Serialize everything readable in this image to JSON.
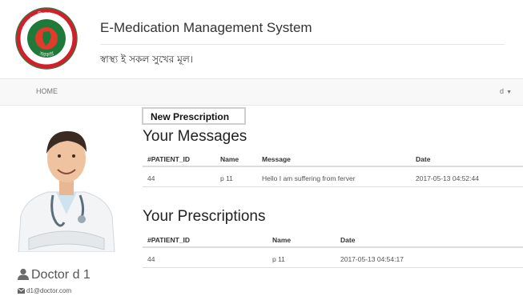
{
  "header": {
    "app_title": "E-Medication Management System",
    "tagline": "স্বাস্থ্য ই সকল সুখের মূল।"
  },
  "logo": {
    "top_text": "গণপ্রজাতন্ত্রী বাংলাদেশ",
    "bottom_text": "সরকার",
    "colors": {
      "ring": "#d11f2b",
      "green": "#1f7a3a",
      "red": "#e23a2b"
    }
  },
  "navbar": {
    "home_label": "HOME",
    "user_label": "d",
    "user_caret": "▼"
  },
  "profile": {
    "name": "Doctor d 1",
    "email": "d1@doctor.com",
    "icons": [
      "user-icon",
      "envelope-icon"
    ]
  },
  "actions": {
    "new_prescription_label": "New Prescription"
  },
  "messages": {
    "title": "Your Messages",
    "columns": [
      "#PATIENT_ID",
      "Name",
      "Message",
      "Date"
    ],
    "rows": [
      [
        "44",
        "p 11",
        "Hello I am suffering from ferver",
        "2017-05-13 04:52:44"
      ]
    ]
  },
  "prescriptions": {
    "title": "Your Prescriptions",
    "columns": [
      "#PATIENT_ID",
      "Name",
      "Date"
    ],
    "rows": [
      [
        "44",
        "p 11",
        "2017-05-13 04:54:17"
      ]
    ]
  }
}
